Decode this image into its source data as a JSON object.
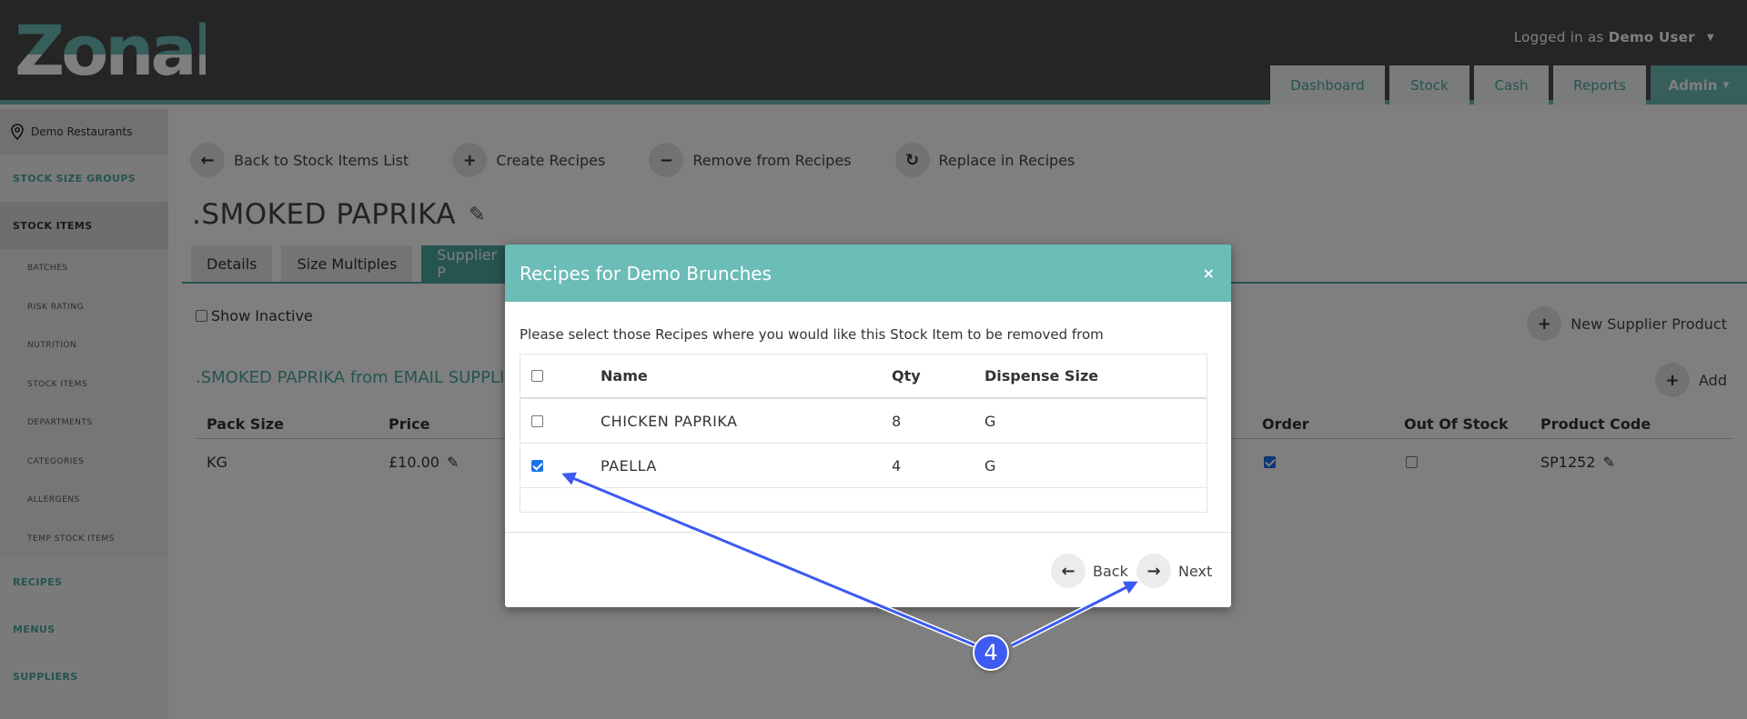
{
  "header": {
    "logo_text": "Zonal",
    "logged_in_prefix": "Logged in as",
    "user_name": "Demo User",
    "nav": [
      "Dashboard",
      "Stock",
      "Cash",
      "Reports",
      "Admin"
    ],
    "active_nav": "Admin"
  },
  "sidebar": {
    "location": "Demo Restaurants",
    "groups": {
      "stock_size_groups": "STOCK SIZE GROUPS",
      "stock_items": "STOCK ITEMS",
      "recipes": "RECIPES",
      "menus": "MENUS",
      "suppliers": "SUPPLIERS"
    },
    "sub_items": [
      "BATCHES",
      "RISK RATING",
      "NUTRITION",
      "STOCK ITEMS",
      "DEPARTMENTS",
      "CATEGORIES",
      "ALLERGENS",
      "TEMP STOCK ITEMS"
    ]
  },
  "main": {
    "actions": [
      "Back to Stock Items List",
      "Create Recipes",
      "Remove from Recipes",
      "Replace in Recipes"
    ],
    "title": ".SMOKED PAPRIKA",
    "tabs": [
      "Details",
      "Size Multiples",
      "Supplier P"
    ],
    "show_inactive_label": "Show Inactive",
    "new_supplier_label": "New Supplier Product",
    "sub_title": ".SMOKED PAPRIKA from EMAIL SUPPLIER",
    "add_label": "Add",
    "table": {
      "columns": {
        "pack_size": "Pack Size",
        "price": "Price",
        "order": "Order",
        "out_of_stock": "Out Of Stock",
        "product_code": "Product Code"
      },
      "row": {
        "pack_size": "KG",
        "price": "£10.00",
        "order": true,
        "out_of_stock": false,
        "product_code": "SP1252"
      }
    }
  },
  "modal": {
    "title": "Recipes for Demo Brunches",
    "close": "×",
    "description": "Please select those Recipes where you would like this Stock Item to be removed from",
    "columns": {
      "name": "Name",
      "qty": "Qty",
      "dispense_size": "Dispense Size"
    },
    "rows": [
      {
        "name": "CHICKEN PAPRIKA",
        "qty": "8",
        "dispense_size": "G",
        "checked": false
      },
      {
        "name": "PAELLA",
        "qty": "4",
        "dispense_size": "G",
        "checked": true
      }
    ],
    "back_label": "Back",
    "next_label": "Next"
  },
  "annotation": {
    "step_number": "4",
    "color": "#3d5af1"
  },
  "colors": {
    "header_bg": "#4a4a4a",
    "accent": "#6cbcb7",
    "accent_dark": "#4aa8a3"
  }
}
